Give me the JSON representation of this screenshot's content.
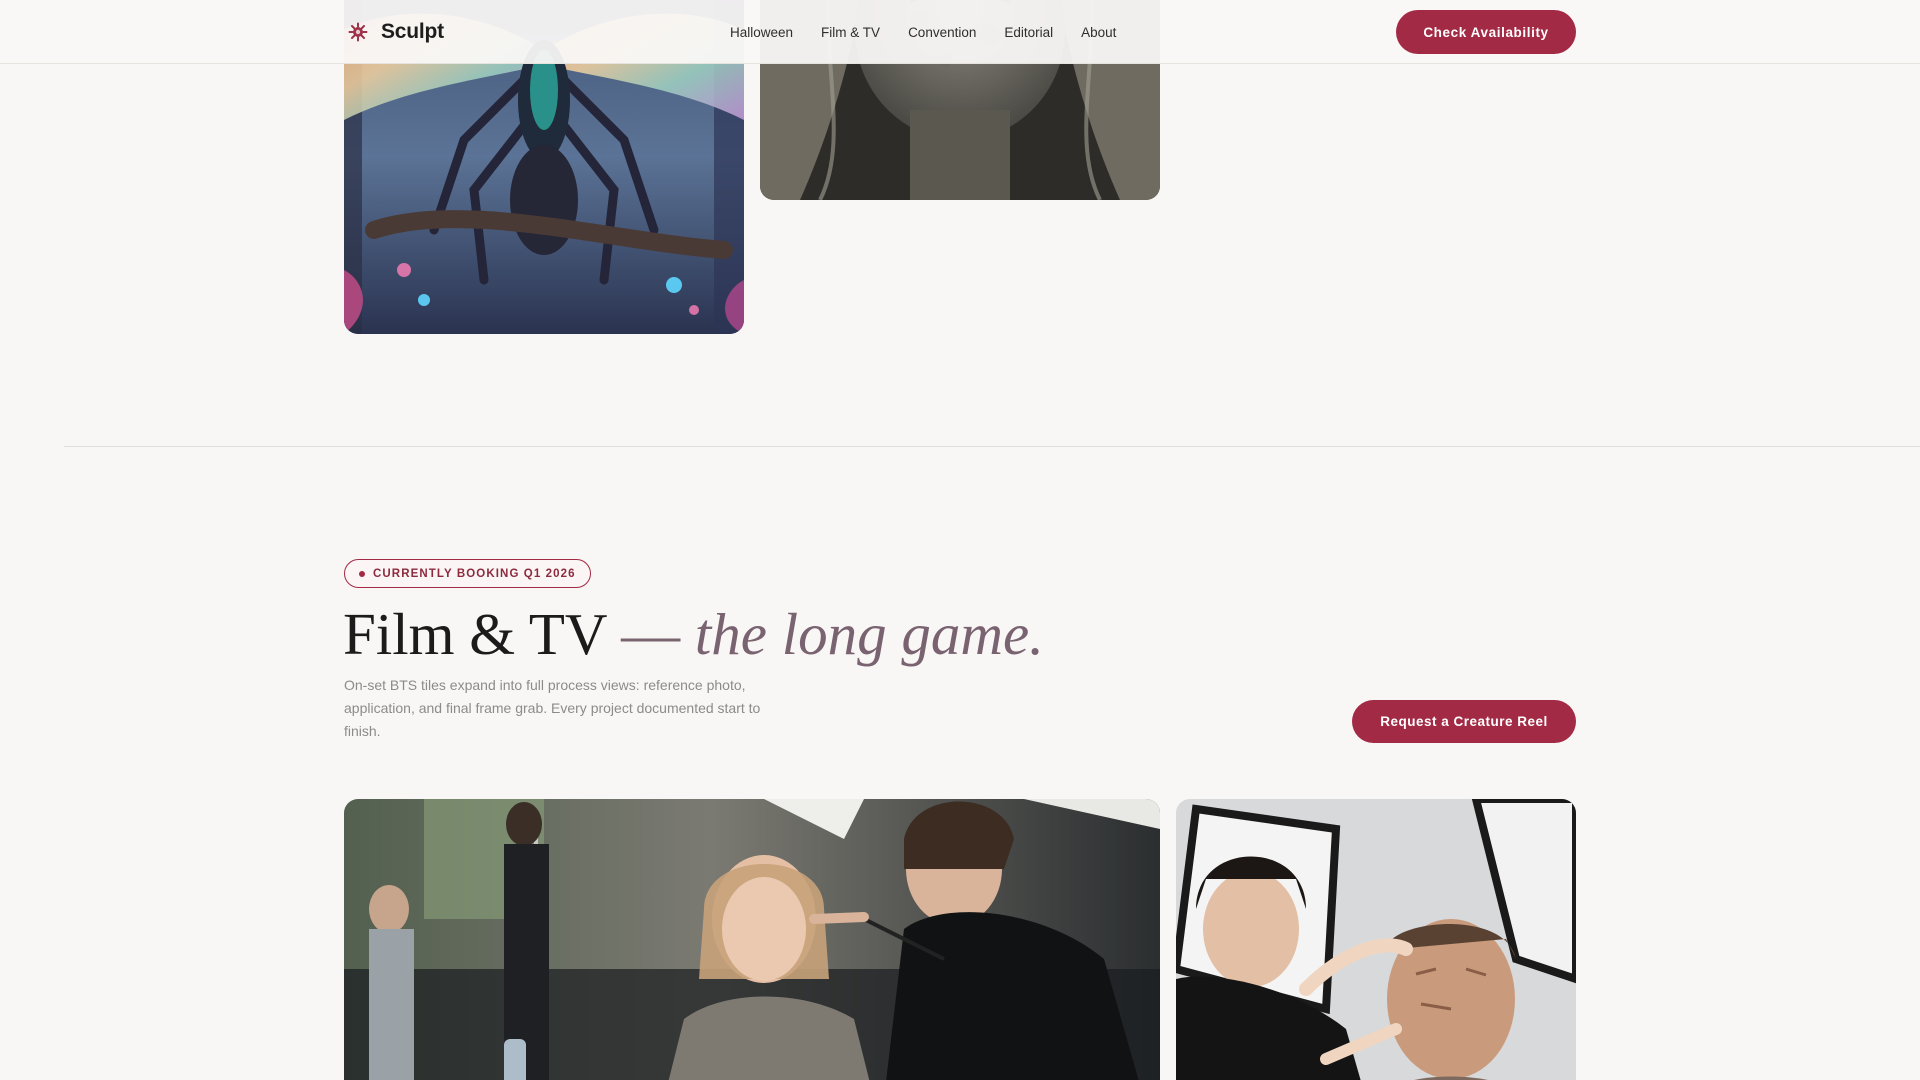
{
  "brand": {
    "name": "Sculpt",
    "icon": "gear-sun-icon"
  },
  "nav": {
    "items": [
      {
        "label": "Halloween"
      },
      {
        "label": "Film & TV"
      },
      {
        "label": "Convention"
      },
      {
        "label": "Editorial"
      },
      {
        "label": "About"
      }
    ]
  },
  "header": {
    "cta_label": "Check Availability"
  },
  "section": {
    "badge": "CURRENTLY BOOKING Q1 2026",
    "title_main": "Film & TV",
    "title_dash": "—",
    "title_accent": "the long game.",
    "description": "On-set BTS tiles expand into full process views: reference photo, application, and final frame grab. Every project documented start to finish.",
    "cta_label": "Request a Creature Reel"
  },
  "colors": {
    "accent": "#a32a44",
    "accent_muted": "#7a6370",
    "background": "#f9f7f5"
  }
}
